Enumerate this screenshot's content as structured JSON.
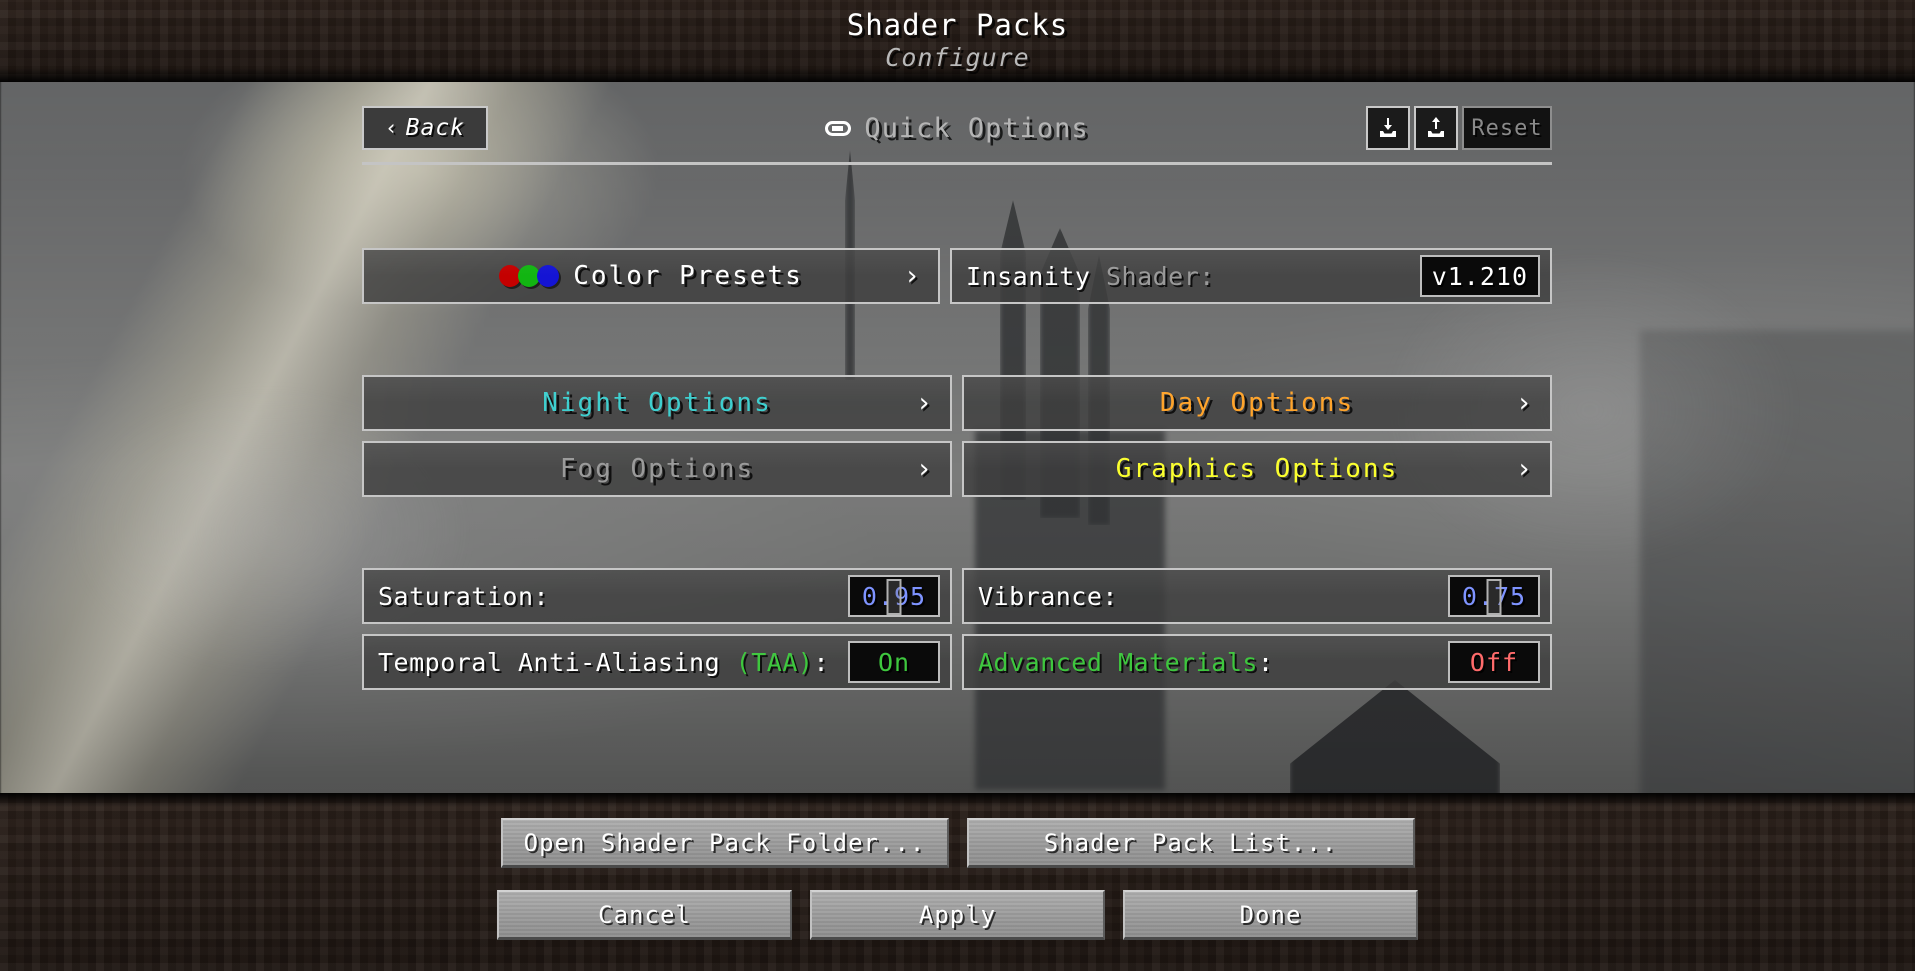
{
  "window": {
    "title": "Shader Packs",
    "subtitle": "Configure"
  },
  "header": {
    "back_label": "Back",
    "back_chevron": "‹",
    "screen_title": "Quick Options",
    "title_icon": "pill-icon",
    "import_icon": "import-tray-icon",
    "export_icon": "export-tray-icon",
    "reset_label": "Reset"
  },
  "options": {
    "color_presets": {
      "label": "Color Presets",
      "label_color": "#ffffff",
      "chevron": "›",
      "swatches": [
        "#c40000",
        "#12b512",
        "#1414d4"
      ]
    },
    "insanity_shader": {
      "label_strong": "Insanity",
      "label_rest": " Shader:",
      "value": "v1.210",
      "value_color": "#ffffff"
    },
    "night_options": {
      "label": "Night Options",
      "label_color": "#3ecfcf",
      "chevron": "›"
    },
    "day_options": {
      "label": "Day Options",
      "label_color": "#ffa42b",
      "chevron": "›"
    },
    "fog_options": {
      "label": "Fog Options",
      "label_color": "#9a9a9a",
      "chevron": "›"
    },
    "graphics_options": {
      "label": "Graphics Options",
      "label_color": "#fbff2e",
      "chevron": "›"
    },
    "saturation": {
      "label": "Saturation:",
      "value": "0.95",
      "value_color": "#7e93ff"
    },
    "vibrance": {
      "label": "Vibrance:",
      "value": "0.75",
      "value_color": "#7e93ff"
    },
    "taa": {
      "label_main": "Temporal Anti-Aliasing ",
      "label_tag": "(TAA)",
      "label_colon": ":",
      "value": "On",
      "value_color": "#3ec73e"
    },
    "advanced_materials": {
      "label_main": "Advanced Materials",
      "label_colon": ":",
      "value": "Off",
      "value_color": "#ff6b6b"
    }
  },
  "footer": {
    "open_folder": "Open Shader Pack Folder...",
    "shader_pack_list": "Shader Pack List...",
    "cancel": "Cancel",
    "apply": "Apply",
    "done": "Done"
  }
}
